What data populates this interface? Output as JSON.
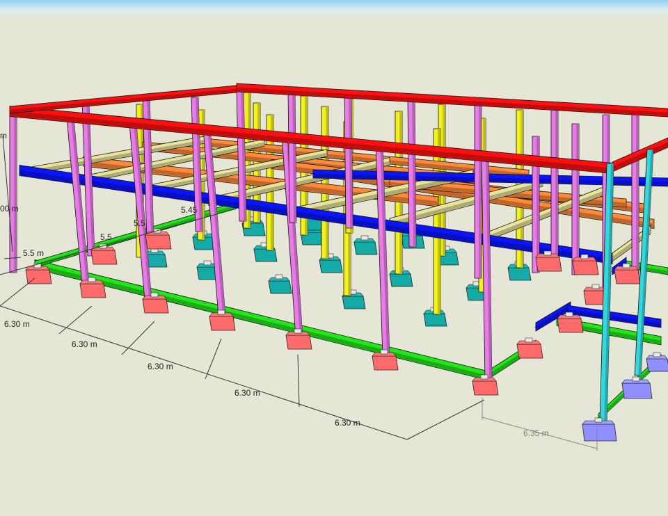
{
  "dimensions": {
    "bay_1": "6.30 m",
    "bay_2": "6.30 m",
    "bay_3": "6.30 m",
    "bay_4": "6.30 m",
    "bay_5": "6.30 m",
    "side_bay": "6.35 m",
    "left_a": "5.45",
    "left_b": "5.5",
    "left_c": "5.5",
    "left_d": "5.5",
    "left_e": "5.5 m",
    "height": "00 m",
    "top_cut": "m"
  },
  "colors": {
    "roof_beam": "#ff1010",
    "column": "#e97be9",
    "mid_beam": "#0a14ff",
    "ground_beam": "#22e61a",
    "joist_orange": "#ff8a3a",
    "joist_khaki": "#e8e49a",
    "interior_column": "#f2f21a",
    "footing_red": "#ff6a6a",
    "footing_teal": "#14aaa6",
    "footing_purple": "#8f8fff",
    "cyan_column": "#34d8dc"
  },
  "components": {
    "roof_beams": "roof-beam",
    "columns": "column",
    "footings": "footing"
  }
}
